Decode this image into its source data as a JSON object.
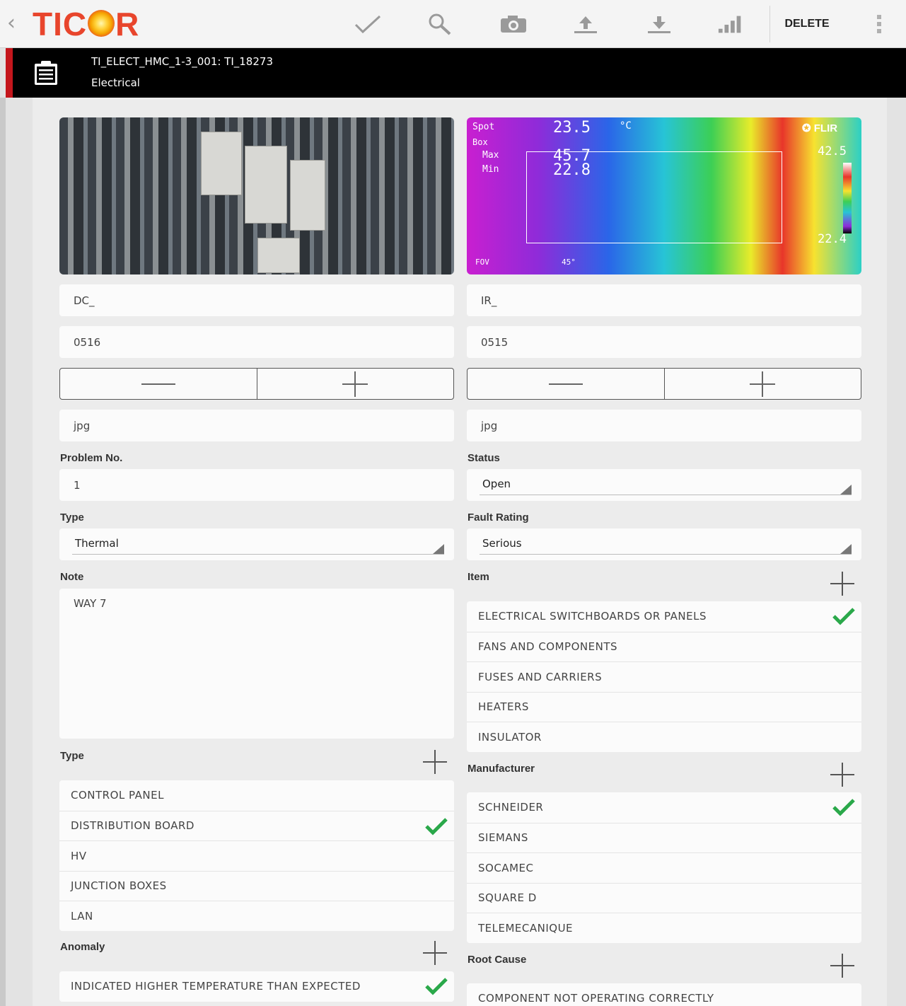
{
  "toolbar": {
    "back_icon": "chevron-left-icon",
    "logo_text_1": "TIC",
    "logo_text_2": "R",
    "delete_label": "DELETE",
    "icons": [
      "checkmark-icon",
      "search-icon",
      "camera-icon",
      "upload-icon",
      "download-icon",
      "signal-bars-icon",
      "more-vert-icon"
    ]
  },
  "header": {
    "title": "TI_ELECT_HMC_1-3_001: TI_18273",
    "subtitle": "Electrical",
    "icon": "clipboard-icon"
  },
  "images": {
    "ir_overlay": {
      "spot_label": "Spot",
      "spot_value": "23.5",
      "unit": "°C",
      "box_label": "Box",
      "max_label": "Max",
      "max_value": "45.7",
      "min_label": "Min",
      "min_value": "22.8",
      "brand": "FLIR",
      "scale_max": "42.5",
      "scale_min": "22.4",
      "fov_label": "FOV",
      "fov_value": "45°"
    }
  },
  "left": {
    "prefix": "DC_",
    "number": "0516",
    "extension": "jpg",
    "problem_label": "Problem No.",
    "problem_value": "1",
    "type_label": "Type",
    "type_value": "Thermal",
    "note_label": "Note",
    "note_value": "WAY 7",
    "type_list_label": "Type",
    "type_list": [
      {
        "label": "CONTROL PANEL",
        "checked": false
      },
      {
        "label": "DISTRIBUTION BOARD",
        "checked": true
      },
      {
        "label": "HV",
        "checked": false
      },
      {
        "label": "JUNCTION BOXES",
        "checked": false
      },
      {
        "label": "LAN",
        "checked": false
      }
    ],
    "anomaly_label": "Anomaly",
    "anomaly_list": [
      {
        "label": "INDICATED HIGHER TEMPERATURE THAN EXPECTED",
        "checked": true
      }
    ]
  },
  "right": {
    "prefix": "IR_",
    "number": "0515",
    "extension": "jpg",
    "status_label": "Status",
    "status_value": "Open",
    "fault_label": "Fault Rating",
    "fault_value": "Serious",
    "item_label": "Item",
    "item_list": [
      {
        "label": "ELECTRICAL SWITCHBOARDS OR PANELS",
        "checked": true
      },
      {
        "label": "FANS AND COMPONENTS",
        "checked": false
      },
      {
        "label": "FUSES AND CARRIERS",
        "checked": false
      },
      {
        "label": "HEATERS",
        "checked": false
      },
      {
        "label": "INSULATOR",
        "checked": false
      }
    ],
    "manufacturer_label": "Manufacturer",
    "manufacturer_list": [
      {
        "label": "SCHNEIDER",
        "checked": true
      },
      {
        "label": "SIEMANS",
        "checked": false
      },
      {
        "label": "SOCAMEC",
        "checked": false
      },
      {
        "label": "SQUARE D",
        "checked": false
      },
      {
        "label": "TELEMECANIQUE",
        "checked": false
      }
    ],
    "root_cause_label": "Root Cause",
    "root_cause_list": [
      {
        "label": "COMPONENT NOT OPERATING CORRECTLY",
        "checked": false
      }
    ]
  },
  "colors": {
    "brand": "#e8452c",
    "header_accent": "#c4161c",
    "check": "#2aa84a"
  }
}
